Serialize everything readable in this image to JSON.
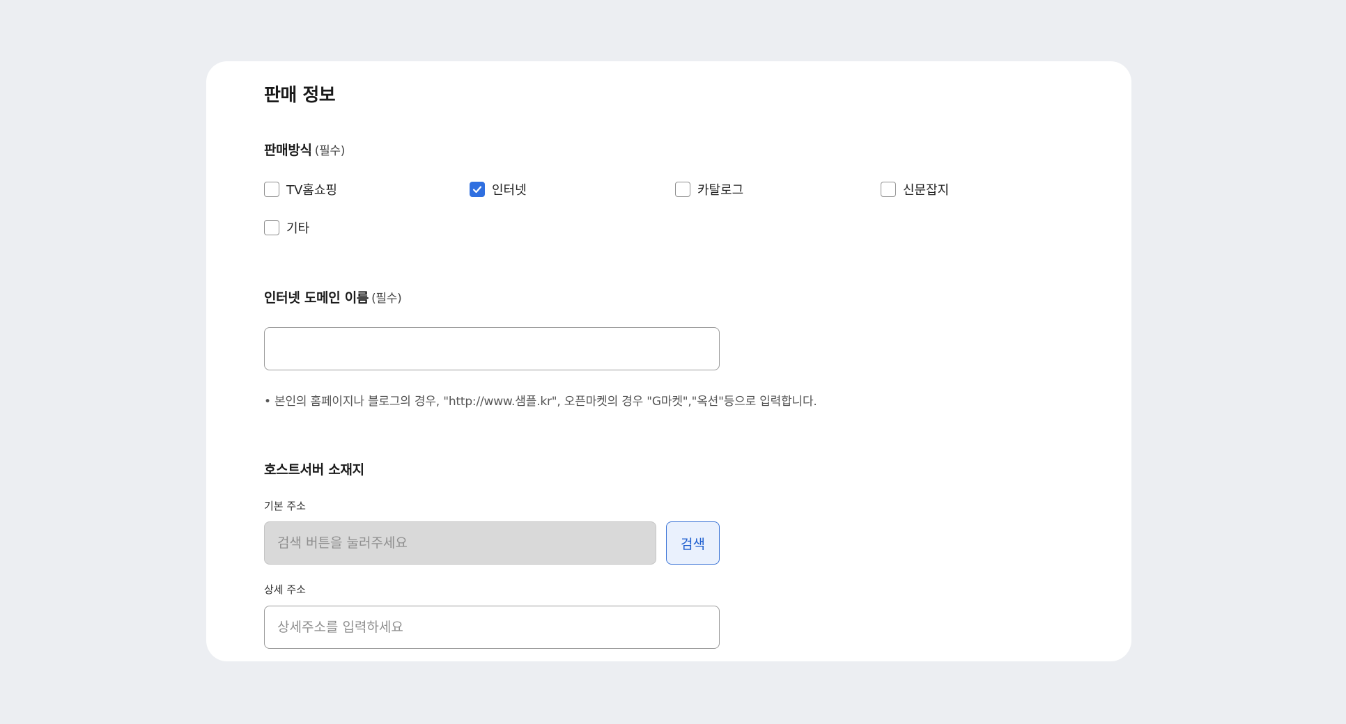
{
  "page_title": "판매 정보",
  "sales_method": {
    "label": "판매방식",
    "required": "(필수)",
    "options": [
      {
        "label": "TV홈쇼핑",
        "checked": false
      },
      {
        "label": "인터넷",
        "checked": true
      },
      {
        "label": "카탈로그",
        "checked": false
      },
      {
        "label": "신문잡지",
        "checked": false
      },
      {
        "label": "기타",
        "checked": false
      }
    ]
  },
  "domain": {
    "label": "인터넷 도메인 이름",
    "required": "(필수)",
    "value": "",
    "hint": "• 본인의 홈페이지나 블로그의 경우, \"http://www.샘플.kr\", 오픈마켓의 경우 \"G마켓\",\"옥션\"등으로 입력합니다."
  },
  "host_server": {
    "label": "호스트서버 소재지",
    "base_address_label": "기본 주소",
    "base_address_placeholder": "검색 버튼을 눌러주세요",
    "search_button": "검색",
    "detail_address_label": "상세 주소",
    "detail_address_placeholder": "상세주소를 입력하세요"
  },
  "colors": {
    "accent": "#2f6fe0",
    "background": "#eceef2",
    "card": "#ffffff"
  }
}
